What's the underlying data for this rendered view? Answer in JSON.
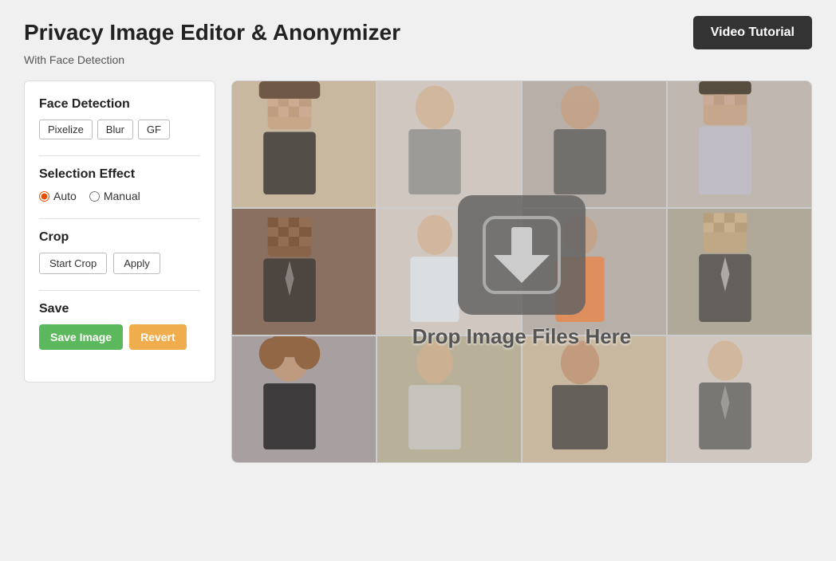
{
  "header": {
    "title": "Privacy Image Editor &  Anonymizer",
    "subtitle": "With Face Detection",
    "video_tutorial_label": "Video Tutorial"
  },
  "left_panel": {
    "face_detection": {
      "title": "Face Detection",
      "buttons": [
        {
          "label": "Pixelize",
          "id": "pixelize"
        },
        {
          "label": "Blur",
          "id": "blur"
        },
        {
          "label": "GF",
          "id": "gf"
        }
      ]
    },
    "selection_effect": {
      "title": "Selection Effect",
      "options": [
        {
          "label": "Auto",
          "value": "auto",
          "checked": true
        },
        {
          "label": "Manual",
          "value": "manual",
          "checked": false
        }
      ]
    },
    "crop": {
      "title": "Crop",
      "start_crop_label": "Start Crop",
      "apply_label": "Apply"
    },
    "save": {
      "title": "Save",
      "save_image_label": "Save Image",
      "revert_label": "Revert"
    }
  },
  "drop_area": {
    "drop_text": "Drop Image Files Here"
  }
}
